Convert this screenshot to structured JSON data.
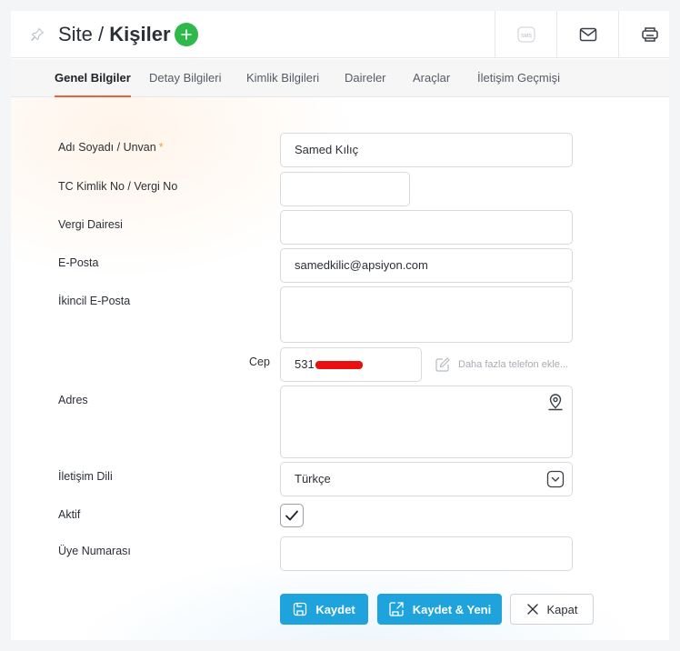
{
  "header": {
    "crumb": "Site",
    "separator": " / ",
    "current": "Kişiler",
    "sms_label": "SMS"
  },
  "tabs": [
    {
      "label": "Genel Bilgiler"
    },
    {
      "label": "Detay Bilgileri"
    },
    {
      "label": "Kimlik Bilgileri"
    },
    {
      "label": "Daireler"
    },
    {
      "label": "Araçlar"
    },
    {
      "label": "İletişim Geçmişi"
    }
  ],
  "active_tab": "Genel Bilgiler",
  "form": {
    "name": {
      "label": "Adı Soyadı / Unvan",
      "required_mark": "*",
      "value": "Samed Kılıç"
    },
    "tc": {
      "label": "TC Kimlik No / Vergi No",
      "value": ""
    },
    "tax_office": {
      "label": "Vergi Dairesi",
      "value": ""
    },
    "email": {
      "label": "E-Posta",
      "value": "samedkilic@apsiyon.com"
    },
    "email2": {
      "label": "İkincil E-Posta",
      "value": ""
    },
    "mobile": {
      "label": "Cep",
      "value": "531",
      "more_phone_label": "Daha fazla telefon ekle..."
    },
    "address": {
      "label": "Adres",
      "value": ""
    },
    "language": {
      "label": "İletişim Dili",
      "value": "Türkçe"
    },
    "active": {
      "label": "Aktif",
      "checked": true
    },
    "member_no": {
      "label": "Üye Numarası",
      "value": ""
    }
  },
  "buttons": {
    "save": "Kaydet",
    "save_new": "Kaydet & Yeni",
    "close": "Kapat"
  },
  "colors": {
    "primary": "#1ea3dc",
    "add": "#2fb84c",
    "tab_underline": "#e8623d",
    "required": "#e8a23d",
    "redaction": "#e8110f"
  }
}
